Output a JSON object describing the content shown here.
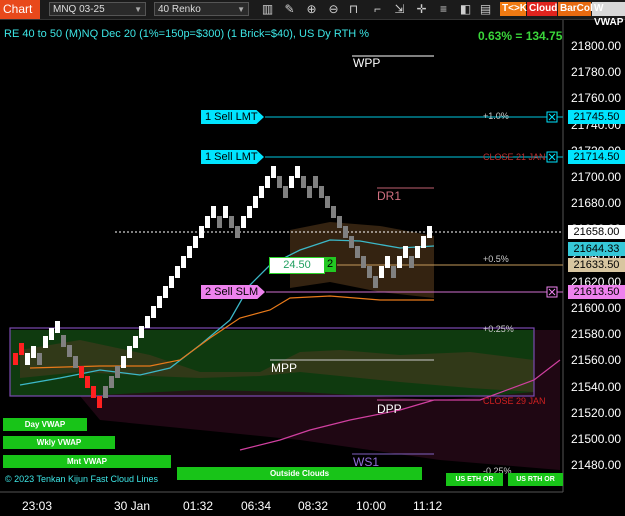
{
  "toolbar": {
    "title": "Chart",
    "instrument": "MNQ 03-25",
    "period": "40 Renko",
    "buttons": [
      "T<>K",
      "Cloud",
      "BarCol",
      "W VWAP"
    ],
    "icons": [
      "bar-style-icon",
      "draw-icon",
      "zoom-in-icon",
      "zoom-out-icon",
      "magnet-icon",
      "pointer-icon",
      "scroll-icon",
      "crosshair-icon",
      "properties-icon",
      "hide-icon",
      "stats-icon"
    ]
  },
  "chart": {
    "header_text": "RE 40 to 50 (M)NQ Dec 20 (1%=150p=$300) (1 Brick=$40), US Dy RTH %",
    "change_text": "0.63% = 134.75",
    "price_axis": [
      "21800.00",
      "21780.00",
      "21760.00",
      "21740.00",
      "21720.00",
      "21700.00",
      "21680.00",
      "21660.00",
      "21640.00",
      "21620.00",
      "21600.00",
      "21580.00",
      "21560.00",
      "21540.00",
      "21520.00",
      "21500.00",
      "21480.00"
    ],
    "time_axis": [
      "23:03",
      "30 Jan",
      "01:32",
      "06:34",
      "08:32",
      "10:00",
      "11:12"
    ],
    "price_tags": [
      {
        "text": "21745.50",
        "color": "#00e5ff"
      },
      {
        "text": "21714.50",
        "color": "#00e5ff"
      },
      {
        "text": "21658.00",
        "color": "#ffffff"
      },
      {
        "text": "21644.33",
        "color": "#36c8d8"
      },
      {
        "text": "21633.50",
        "color": "#d8c6a0"
      },
      {
        "text": "21613.50",
        "color": "#ee82ee"
      }
    ],
    "orders": [
      {
        "label": "1 Sell LMT",
        "color": "#00e5ff"
      },
      {
        "label": "1 Sell LMT",
        "color": "#00e5ff"
      },
      {
        "label": "2 Sell SLM",
        "color": "#ee82ee"
      }
    ],
    "order_marker": {
      "price": "24.50",
      "qty": "2"
    },
    "pivots": {
      "wpp": "WPP",
      "dr1": "DR1",
      "mpp": "MPP",
      "dpp": "DPP",
      "ws1": "WS1"
    },
    "pct_labels": [
      "+1.0%",
      "+0.5%",
      "+0.25%",
      "-0.25%"
    ],
    "close_labels": [
      "CLOSE 21 JAN",
      "CLOSE 29 JAN"
    ],
    "vwap_buttons": [
      "Day VWAP",
      "Wkly VWAP",
      "Mnt VWAP",
      "Outside Clouds",
      "US ETH OR",
      "US RTH OR"
    ],
    "footer_text": "© 2023 Tenkan Kijun Fast Cloud Lines",
    "colors": {
      "up_brick": "#ffffff",
      "down_brick": "#808080",
      "strong_down": "#ff2020",
      "axis": "#ffffff",
      "cyan": "#00e5ff",
      "green": "#22d022"
    }
  }
}
